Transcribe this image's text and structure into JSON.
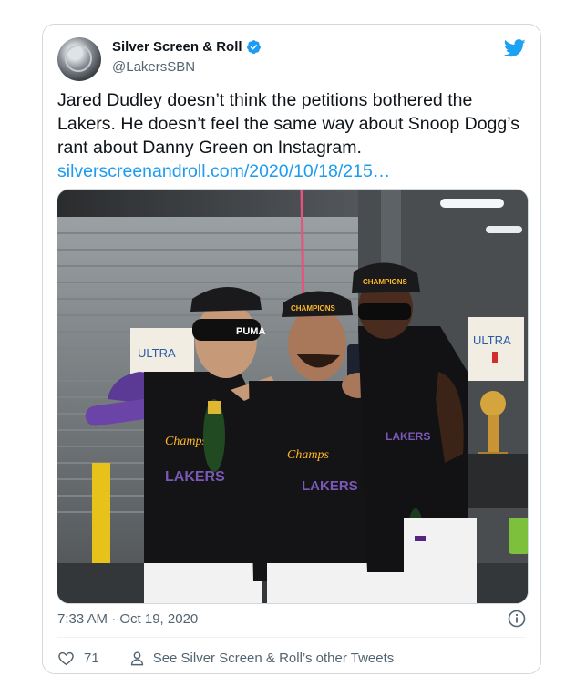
{
  "account": {
    "name": "Silver Screen & Roll",
    "handle": "@LakersSBN"
  },
  "tweet": {
    "text": "Jared Dudley doesn’t think the petitions bothered the Lakers. He doesn’t feel the same way about Snoop Dogg’s rant about Danny Green on Instagram. ",
    "link_text": "silverscreenandroll.com/2020/10/18/215…",
    "timestamp": "7:33 AM · Oct 19, 2020",
    "likes": "71",
    "other_tweets_label": "See Silver Screen & Roll’s other Tweets"
  },
  "photo": {
    "signs": [
      "ULTRA",
      "ULTRA"
    ],
    "hat_text": "CHAMPIONS",
    "shirt_text": "LAKERS",
    "shirt_title": "Champs",
    "mask_text": "PUMA"
  },
  "colors": {
    "accent": "#1d9bf0",
    "twitter_blue": "#1da1f2",
    "lakers_purple": "#552583",
    "lakers_gold": "#fdb927"
  },
  "icons": {
    "verified": "verified-badge-icon",
    "bird": "twitter-bird-icon",
    "info": "info-icon",
    "like": "heart-icon",
    "profile": "person-icon"
  }
}
